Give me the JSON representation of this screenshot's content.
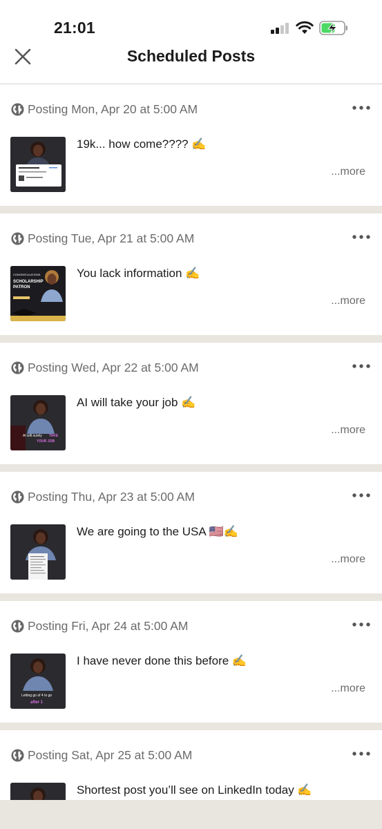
{
  "status": {
    "time": "21:01"
  },
  "nav": {
    "title": "Scheduled Posts"
  },
  "posts": [
    {
      "when": "Posting Mon, Apr 20 at 5:00 AM",
      "text": "19k... how come???? ✍️",
      "more": "...more"
    },
    {
      "when": "Posting Tue, Apr 21 at 5:00 AM",
      "text": "You lack information ✍️",
      "more": "...more",
      "thumb": {
        "line1": "CONGRATULATIONS",
        "line2": "SCHOLARSHIP",
        "line3": "PATRON"
      }
    },
    {
      "when": "Posting Wed, Apr 22 at 5:00 AM",
      "text": "AI will take your job ✍️",
      "more": "...more",
      "thumb": {
        "line1": "AI will surely",
        "line2": "TAKE",
        "line3": "YOUR JOB"
      }
    },
    {
      "when": "Posting Thu, Apr 23 at 5:00 AM",
      "text": "We are going to the USA 🇺🇸✍️",
      "more": "...more"
    },
    {
      "when": "Posting Fri, Apr 24 at 5:00 AM",
      "text": "I have never done this before ✍️",
      "more": "...more",
      "thumb": {
        "line1": "Letting go of 4 to go",
        "line2": "after 1"
      }
    },
    {
      "when": "Posting Sat, Apr 25 at 5:00 AM",
      "text": "Shortest post you’ll see on LinkedIn today ✍️",
      "more": ""
    }
  ],
  "icons": {
    "close": "close-icon",
    "globe": "globe-icon",
    "more": "more-options-icon",
    "signal": "cellular-signal-icon",
    "wifi": "wifi-icon",
    "battery": "battery-charging-icon"
  },
  "colors": {
    "background": "#e9e5df",
    "card": "#ffffff",
    "muted": "#6b6b6b",
    "battery": "#4cd964"
  }
}
